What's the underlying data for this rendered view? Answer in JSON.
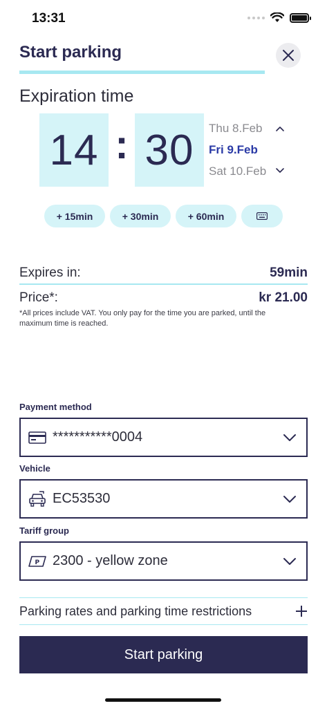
{
  "status_bar": {
    "time": "13:31",
    "wifi_icon": "wifi-icon",
    "battery_icon": "battery-icon"
  },
  "header": {
    "title": "Start parking",
    "close_icon": "close-icon"
  },
  "expiration": {
    "heading": "Expiration time",
    "hours": "14",
    "separator": ":",
    "minutes": "30",
    "dates": {
      "previous": "Thu 8.Feb",
      "selected": "Fri 9.Feb",
      "next": "Sat 10.Feb"
    },
    "quick_add": [
      "+ 15min",
      "+ 30min",
      "+ 60min"
    ],
    "keyboard_icon": "keyboard-icon"
  },
  "summary": {
    "expires_label": "Expires in:",
    "expires_value": "59min",
    "price_label": "Price*:",
    "price_value": "kr 21.00",
    "footnote": "*All prices include VAT. You only pay for the time you are parked, until the maximum time is reached."
  },
  "payment": {
    "label": "Payment method",
    "value": "***********0004",
    "icon": "credit-card-icon"
  },
  "vehicle": {
    "label": "Vehicle",
    "value": "EC53530",
    "icon": "car-icon"
  },
  "tariff": {
    "label": "Tariff group",
    "value": "2300 - yellow zone",
    "icon": "parking-sign-icon"
  },
  "rates": {
    "label": "Parking rates and parking time restrictions",
    "icon": "plus-icon"
  },
  "cta": {
    "label": "Start parking"
  },
  "colors": {
    "primary": "#2b2a52",
    "accent": "#a7e8f1",
    "accent_light": "#d5f4f8",
    "selected_date": "#2a3aa6"
  }
}
